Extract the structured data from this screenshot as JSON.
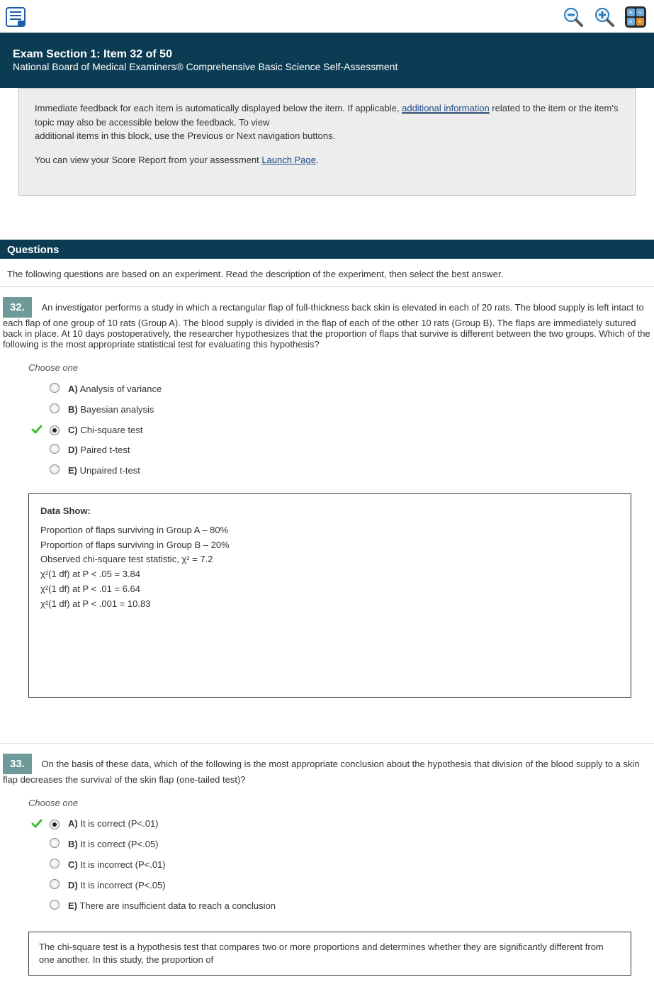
{
  "toolbar": {
    "notes_icon": "notes-icon",
    "zoom_out_icon": "zoom-out-icon",
    "zoom_in_icon": "zoom-in-icon",
    "calc_icon": "calculator-icon"
  },
  "header": {
    "title": "Exam Section 1: Item 32 of 50",
    "sub": "National Board of Medical Examiners® Comprehensive Basic Science Self-Assessment"
  },
  "instructions": {
    "p1_lead": "Immediate feedback for each item is automatically displayed below the item. If applicable,",
    "p1_link_text": "additional information",
    "p1_tail": " related to the item or the item's topic may also be accessible below the feedback. To view",
    "p2": "additional items in this block, use the Previous or Next navigation buttons.",
    "p3_lead": "You can view your Score Report from your assessment ",
    "p3_link_text": "Launch Page",
    "p3_tail": "."
  },
  "sections": {
    "questions_label": "Questions",
    "intro": "The following questions are based on an experiment. Read the description of the experiment, then select the best answer."
  },
  "q32": {
    "num": "32.",
    "text": "An investigator performs a study in which a rectangular flap of full-thickness back skin is elevated in each of 20 rats. The blood supply is left intact to each flap of one group of 10 rats (Group A). The blood supply is divided in the flap of each of the other 10 rats (Group B). The flaps are immediately sutured back in place. At 10 days postoperatively, the researcher hypothesizes that the proportion of flaps that survive is different between the two groups. Which of the following is the most appropriate statistical test for evaluating this hypothesis?",
    "choose": "Choose one",
    "options": [
      {
        "key": "A",
        "label": "Analysis of variance"
      },
      {
        "key": "B",
        "label": "Bayesian analysis"
      },
      {
        "key": "C",
        "label": "Chi-square test"
      },
      {
        "key": "D",
        "label": "Paired t-test"
      },
      {
        "key": "E",
        "label": "Unpaired t-test"
      }
    ],
    "selected_index": 2,
    "correct_index": 2,
    "data_box_title": "Data Show:",
    "data_lines": [
      "Proportion of flaps surviving in Group A – 80%",
      "Proportion of flaps surviving in Group B – 20%",
      "Observed chi-square test statistic, χ² = 7.2",
      "χ²(1 df) at P < .05 = 3.84",
      "χ²(1 df) at P < .01 = 6.64",
      "χ²(1 df) at P < .001 = 10.83"
    ]
  },
  "q33": {
    "num": "33.",
    "text": "On the basis of these data, which of the following is the most appropriate conclusion about the hypothesis that division of the blood supply to a skin flap decreases the survival of the skin flap (one-tailed test)?",
    "choose": "Choose one",
    "options": [
      {
        "key": "A",
        "label": "It is correct (P<.01)"
      },
      {
        "key": "B",
        "label": "It is correct (P<.05)"
      },
      {
        "key": "C",
        "label": "It is incorrect (P<.01)"
      },
      {
        "key": "D",
        "label": "It is incorrect (P<.05)"
      },
      {
        "key": "E",
        "label": "There are insufficient data to reach a conclusion"
      }
    ],
    "selected_index": 0,
    "correct_index": 0,
    "feedback": "The chi-square test is a hypothesis test that compares two or more proportions and determines whether they are significantly different from one another. In this study, the proportion of",
    "ref": ""
  }
}
